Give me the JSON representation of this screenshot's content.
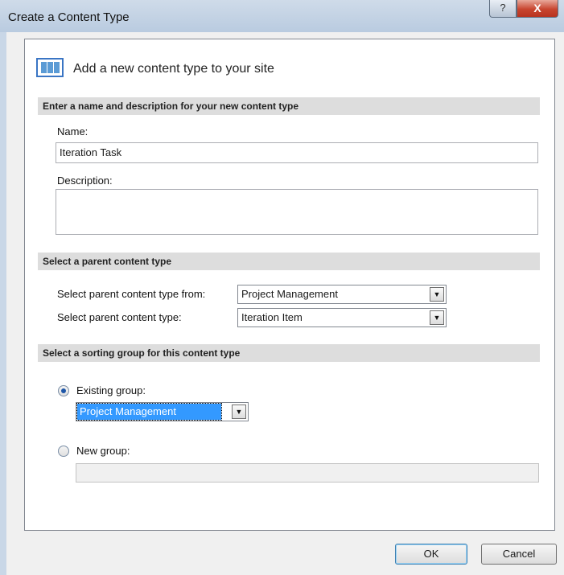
{
  "window": {
    "title": "Create a Content Type",
    "help_label": "?",
    "close_label": "X"
  },
  "heading": "Add a new content type to your site",
  "section_name": {
    "header": "Enter a name and description for your new content type",
    "name_label": "Name:",
    "name_value": "Iteration Task",
    "description_label": "Description:",
    "description_value": ""
  },
  "section_parent": {
    "header": "Select a parent content type",
    "from_label": "Select parent content type from:",
    "from_value": "Project Management",
    "type_label": "Select parent content type:",
    "type_value": "Iteration Item"
  },
  "section_group": {
    "header": "Select a sorting group for this content type",
    "existing_label": "Existing group:",
    "existing_selected": true,
    "existing_value": "Project Management",
    "new_label": "New group:",
    "new_selected": false,
    "new_value": ""
  },
  "buttons": {
    "ok": "OK",
    "cancel": "Cancel"
  },
  "dropdown_arrow": "▼",
  "icons": {
    "header": "content-type-icon",
    "dropdown": "chevron-down-icon"
  }
}
